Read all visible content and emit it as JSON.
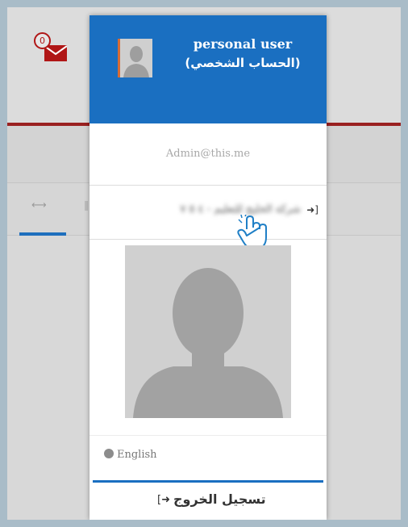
{
  "notifications": {
    "count": "0"
  },
  "user_menu": {
    "username": "personal user",
    "role": "(الحساب الشخصي)",
    "email": "Admin@this.me",
    "switch_account_label": "شركة الخليج للتعليم - ٤ ٥ ٧",
    "language_label": "English",
    "logout_label": "تسجيل الخروج"
  },
  "icons": {
    "mail": "mail-icon",
    "switch": "sign-in-icon",
    "globe": "globe-icon",
    "logout": "sign-out-icon",
    "cursor": "hand-pointer-icon"
  },
  "colors": {
    "header_blue": "#1a6fc1",
    "accent_red": "#9a2020",
    "badge_red": "#b01616",
    "frame": "#a9bcc8"
  }
}
